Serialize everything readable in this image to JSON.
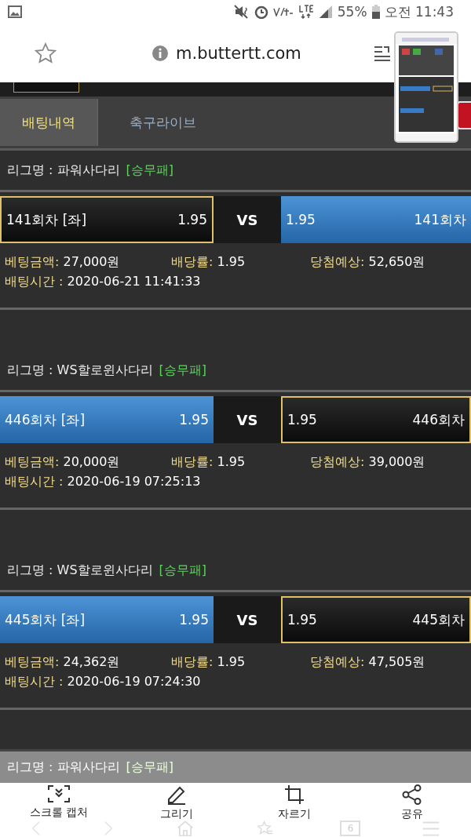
{
  "status_bar": {
    "battery": "55%",
    "time": "오전 11:43"
  },
  "address_bar": {
    "url": "m.buttertt.com"
  },
  "tabs": [
    {
      "label": "배팅내역",
      "selected": true
    },
    {
      "label": "축구라이브",
      "selected": false
    }
  ],
  "bets": [
    {
      "league_label": "리그명 : 파워사다리",
      "bet_type": "[승무패]",
      "left": {
        "round": "141회차 [좌]",
        "odds": "1.95",
        "selected": false
      },
      "vs": "VS",
      "right": {
        "odds": "1.95",
        "round": "141회차",
        "selected": true
      },
      "amount_label": "베팅금액:",
      "amount": "27,000원",
      "rate_label": "배당률:",
      "rate": "1.95",
      "expected_label": "당첨예상:",
      "expected": "52,650원",
      "time_label": "배팅시간 :",
      "time": "2020-06-21 11:41:33"
    },
    {
      "league_label": "리그명 : WS할로윈사다리",
      "bet_type": "[승무패]",
      "left": {
        "round": "446회차 [좌]",
        "odds": "1.95",
        "selected": true
      },
      "vs": "VS",
      "right": {
        "odds": "1.95",
        "round": "446회차",
        "selected": false
      },
      "amount_label": "베팅금액:",
      "amount": "20,000원",
      "rate_label": "배당률:",
      "rate": "1.95",
      "expected_label": "당첨예상:",
      "expected": "39,000원",
      "time_label": "배팅시간 :",
      "time": "2020-06-19 07:25:13"
    },
    {
      "league_label": "리그명 : WS할로윈사다리",
      "bet_type": "[승무패]",
      "left": {
        "round": "445회차 [좌]",
        "odds": "1.95",
        "selected": true
      },
      "vs": "VS",
      "right": {
        "odds": "1.95",
        "round": "445회차",
        "selected": false
      },
      "amount_label": "베팅금액:",
      "amount": "24,362원",
      "rate_label": "배당률:",
      "rate": "1.95",
      "expected_label": "당첨예상:",
      "expected": "47,505원",
      "time_label": "배팅시간 :",
      "time": "2020-06-19 07:24:30"
    }
  ],
  "faded_league": {
    "league_label": "리그명 : 파워사다리",
    "bet_type": "[승무패]"
  },
  "capture_toolbar": [
    {
      "kind": "scroll",
      "label": "스크롤 캡처"
    },
    {
      "kind": "draw",
      "label": "그리기"
    },
    {
      "kind": "crop",
      "label": "자르기"
    },
    {
      "kind": "share",
      "label": "공유"
    }
  ],
  "browser_nav": {
    "tab_count": "6"
  }
}
